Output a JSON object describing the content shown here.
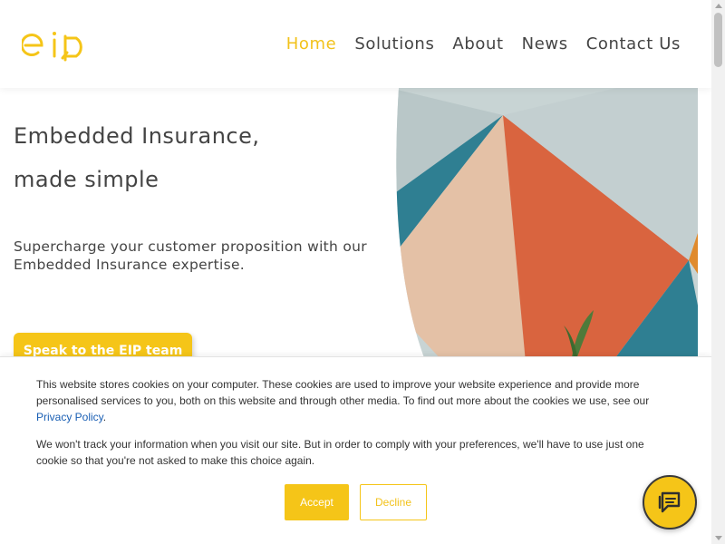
{
  "header": {
    "logo_text": "eip",
    "nav": [
      {
        "label": "Home",
        "active": true
      },
      {
        "label": "Solutions",
        "active": false
      },
      {
        "label": "About",
        "active": false
      },
      {
        "label": "News",
        "active": false
      },
      {
        "label": "Contact Us",
        "active": false
      }
    ]
  },
  "hero": {
    "title_line1": "Embedded Insurance,",
    "title_line2": "made simple",
    "subtitle": "Supercharge your customer proposition with our Embedded Insurance expertise.",
    "cta_label": "Speak to the EIP team"
  },
  "cookie_banner": {
    "text_before_link": "This website stores cookies on your computer. These cookies are used to improve your website experience and provide more personalised services to you, both on this website and through other media. To find out more about the cookies we use, see our ",
    "link_text": "Privacy Policy",
    "text_after_link": ".",
    "paragraph2": "We won't track your information when you visit our site. But in order to comply with your preferences, we'll have to use just one cookie so that you're not asked to make this choice again.",
    "accept_label": "Accept",
    "decline_label": "Decline"
  },
  "colors": {
    "brand_yellow": "#f5c518",
    "text_dark": "#444444",
    "link_blue": "#1a5fb4"
  },
  "icons": {
    "chat": "chat-bubble-icon",
    "logo": "eip-logo"
  }
}
